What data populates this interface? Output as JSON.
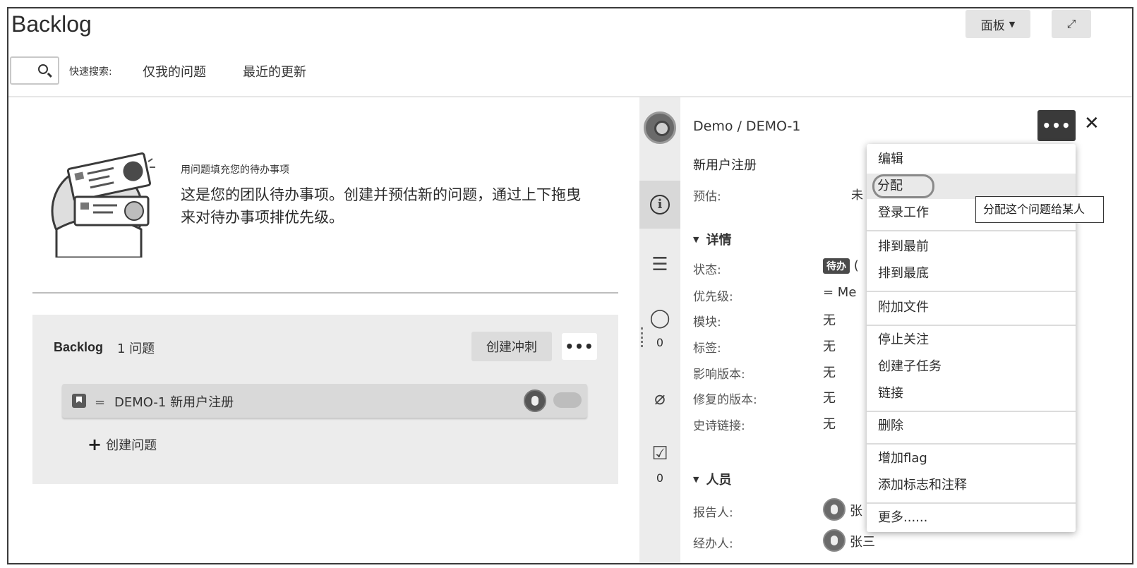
{
  "header": {
    "title": "Backlog",
    "board_label": "面板",
    "chevron_icon": "chevron-down-icon",
    "expand_icon": "expand-icon"
  },
  "quick_search": {
    "label": "快速搜索:",
    "links": [
      "仅我的问题",
      "最近的更新"
    ]
  },
  "empty_state": {
    "heading": "用问题填充您的待办事项",
    "body": "这是您的团队待办事项。创建并预估新的问题，通过上下拖曳来对待办事项排优先级。"
  },
  "backlog": {
    "title": "Backlog",
    "count": "1 问题",
    "create_sprint": "创建冲刺",
    "more": "•••",
    "issues": [
      {
        "priority_icon": "=",
        "key": "DEMO-1",
        "summary": "新用户注册"
      }
    ],
    "create_issue": "创建问题"
  },
  "rail": {
    "comment_count": "0",
    "subtask_count": "0"
  },
  "detail": {
    "breadcrumb": "Demo / DEMO-1",
    "more": "•••",
    "close": "✕",
    "summary": "新用户注册",
    "estimate_label": "预估:",
    "estimate_value": "未",
    "details_heading": "详情",
    "fields": [
      {
        "label": "状态:",
        "value": "待办",
        "suffix": "("
      },
      {
        "label": "优先级:",
        "value": "= Me"
      },
      {
        "label": "模块:",
        "value": "无"
      },
      {
        "label": "标签:",
        "value": "无"
      },
      {
        "label": "影响版本:",
        "value": "无"
      },
      {
        "label": "修复的版本:",
        "value": "无"
      },
      {
        "label": "史诗链接:",
        "value": "无"
      }
    ],
    "people_heading": "人员",
    "people": [
      {
        "label": "报告人:",
        "name": "张"
      },
      {
        "label": "经办人:",
        "name": "张三"
      }
    ]
  },
  "menu": {
    "items": [
      "编辑",
      "分配",
      "登录工作",
      "排到最前",
      "排到最底",
      "附加文件",
      "停止关注",
      "创建子任务",
      "链接",
      "删除",
      "增加flag",
      "添加标志和注释",
      "更多......"
    ]
  },
  "tooltip": "分配这个问题给某人",
  "colors": {
    "menu_bg": "#ffffff",
    "detail_more_bg": "#3a3a3a",
    "panel_bg": "#ececec"
  }
}
